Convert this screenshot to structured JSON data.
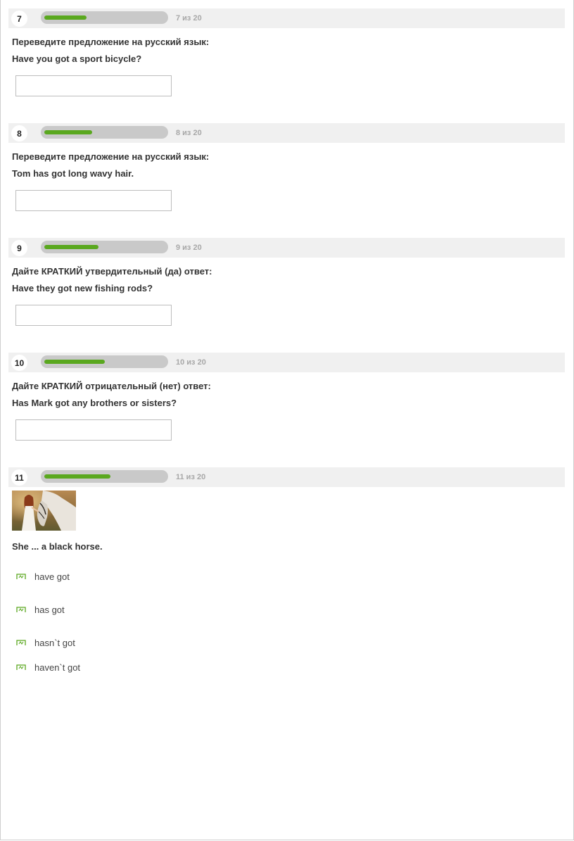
{
  "questions": [
    {
      "number": "7",
      "progress": 0.35,
      "counter": "7 из 20",
      "instruction": "Переведите предложение на русский язык:",
      "sentence": "Have you got a sport bicycle?",
      "answer": ""
    },
    {
      "number": "8",
      "progress": 0.4,
      "counter": "8 из 20",
      "instruction": "Переведите предложение на русский язык:",
      "sentence": "Tom has got long wavy hair.",
      "answer": ""
    },
    {
      "number": "9",
      "progress": 0.45,
      "counter": "9 из 20",
      "instruction": "Дайте КРАТКИЙ утвердительный (да) ответ:",
      "sentence": "Have they got new fishing rods?",
      "answer": ""
    },
    {
      "number": "10",
      "progress": 0.5,
      "counter": "10 из 20",
      "instruction": "Дайте КРАТКИЙ отрицательный (нет) ответ:",
      "sentence": "Has Mark got any brothers or sisters?",
      "answer": ""
    },
    {
      "number": "11",
      "progress": 0.55,
      "counter": "11 из 20",
      "sentence": "She ... a black horse.",
      "options": [
        "have got",
        "has got",
        "hasn`t got",
        "haven`t got"
      ]
    }
  ],
  "colors": {
    "accent": "#5aa81f",
    "track": "#c9c9c9",
    "header_bg": "#f0f0f0"
  },
  "icons": {
    "option_marker": "checkbox-icon",
    "illustration": "girl-with-horse-photo"
  }
}
